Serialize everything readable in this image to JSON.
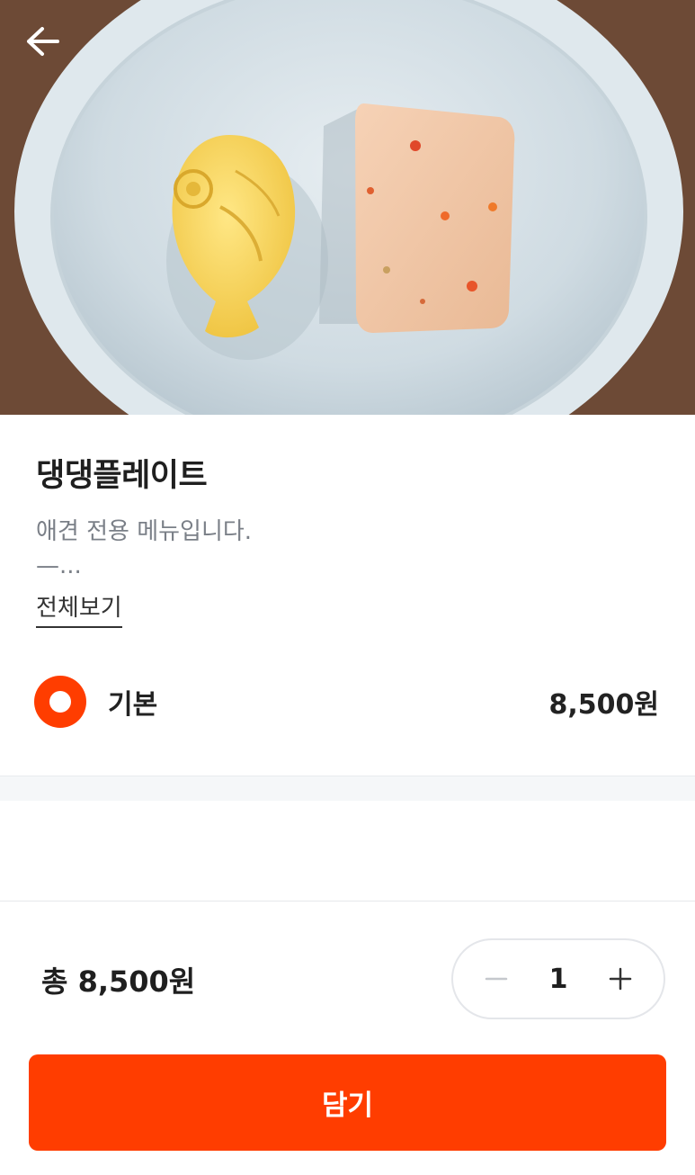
{
  "product": {
    "title": "댕댕플레이트",
    "description_line1": "애견 전용 메뉴입니다.",
    "description_line2": "—...",
    "more_label": "전체보기"
  },
  "option": {
    "label": "기본",
    "price": "8,500원",
    "selected": true
  },
  "footer": {
    "total": "총 8,500원",
    "quantity": "1",
    "add_button_label": "담기"
  },
  "icons": {
    "back": "back-arrow-icon",
    "minus": "minus-icon",
    "plus": "plus-icon"
  },
  "colors": {
    "accent": "#ff3d00",
    "text_primary": "#1f1f1f",
    "text_secondary": "#7a7f87"
  }
}
